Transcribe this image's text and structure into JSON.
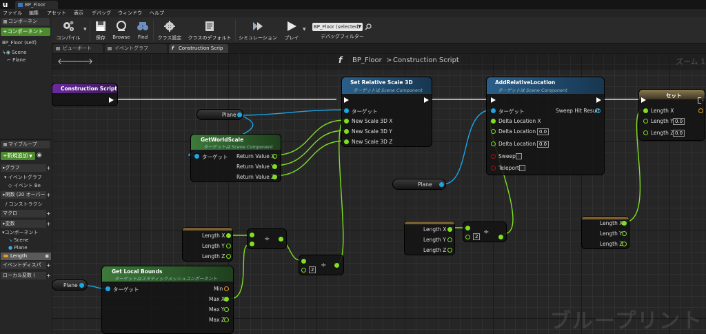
{
  "window": {
    "tab_title": "BP_Floor"
  },
  "menu": [
    "ファイル",
    "編集",
    "アセット",
    "表示",
    "デバッグ",
    "ウィンドウ",
    "ヘルプ"
  ],
  "toolbar": {
    "compile": "コンパイル",
    "save": "保存",
    "browse": "Browse",
    "find": "Find",
    "class_settings": "クラス設定",
    "class_defaults": "クラスのデフォルト",
    "simulation": "シミュレーション",
    "play": "プレイ",
    "debug_object": "BP_Floor (selected)",
    "debug_filter": "デバッグフィルター"
  },
  "components_panel": {
    "tab": "コンポーネン",
    "add_button": "+コンポーネント",
    "self_item": "BP_Floor (self)",
    "tree": [
      "Scene",
      "Plane"
    ]
  },
  "mybp_panel": {
    "tab": "マイブループ",
    "add_new": "+新規追加",
    "categories": [
      {
        "label": "グラフ"
      },
      {
        "label": "イベントグラフ"
      },
      {
        "label": "イベント Be"
      },
      {
        "label": "関数 (20 オーバー"
      },
      {
        "label": "コンストラクシ"
      },
      {
        "label": "マクロ"
      },
      {
        "label": "変数"
      },
      {
        "label": "コンポーネント"
      },
      {
        "label": "Scene"
      },
      {
        "label": "Plane"
      },
      {
        "label": "Length"
      },
      {
        "label": "イベントディスパ"
      },
      {
        "label": "ローカル変数 ("
      }
    ]
  },
  "graph_tabs": [
    "ビューポート",
    "イベントグラフ",
    "Construction Scrip"
  ],
  "breadcrumb": {
    "func_glyph": "f",
    "root": "BP_Floor",
    "separator": ">",
    "current": "Construction Script",
    "zoom": "ズーム 1"
  },
  "nodes": {
    "construction": {
      "title": "Construction Script"
    },
    "set_scale": {
      "title": "Set Relative Scale 3D",
      "subtitle": "ターゲットは Scene Component",
      "pins": [
        "ターゲット",
        "New Scale 3D X",
        "New Scale 3D Y",
        "New Scale 3D Z"
      ]
    },
    "add_loc": {
      "title": "AddRelativeLocation",
      "subtitle": "ターゲットは Scene Component",
      "pins": [
        "ターゲット",
        "Delta Location X",
        "Delta Location Y",
        "Delta Location Z",
        "Sweep",
        "Teleport"
      ],
      "out": "Sweep Hit Result",
      "y_val": "0.0",
      "z_val": "0.0"
    },
    "set_len": {
      "title": "セット",
      "pins": [
        "Length X",
        "Length Y",
        "Length Z"
      ],
      "y_val": "0.0",
      "z_val": "0.0"
    },
    "get_world_scale": {
      "title": "GetWorldScale",
      "subtitle": "ターゲットは Scene Component",
      "in": "ターゲット",
      "outs": [
        "Return Value X",
        "Return Value Y",
        "Return Value Z"
      ]
    },
    "plane_var_1": "Plane",
    "plane_var_2": "Plane",
    "plane_var_3": "Plane",
    "len_var_1": [
      "Length X",
      "Length Y",
      "Length Z"
    ],
    "len_var_2": [
      "Length X",
      "Length Y",
      "Length Z"
    ],
    "len_var_3": [
      "Length X",
      "Length Y",
      "Length Z"
    ],
    "div_1": {
      "op": "÷"
    },
    "div_2": {
      "op": "÷",
      "value": "2"
    },
    "div_3": {
      "op": "÷",
      "value": "2"
    },
    "get_bounds": {
      "title": "Get Local Bounds",
      "subtitle": "ターゲットはスタティックメッシュコンポーネント",
      "in": "ターゲット",
      "outs": [
        "Min",
        "Max X",
        "Max Y",
        "Max Z"
      ]
    }
  },
  "watermark": "ブループリント"
}
